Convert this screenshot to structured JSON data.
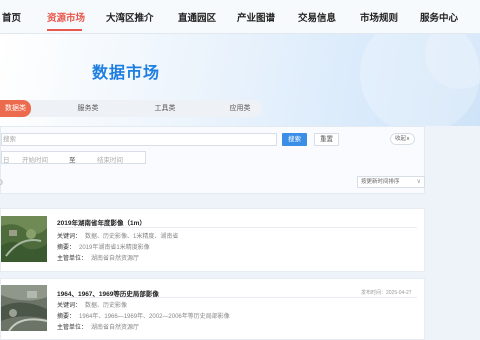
{
  "nav": {
    "items": [
      "首页",
      "资源市场",
      "大湾区推介",
      "直通园区",
      "产业图谱",
      "交易信息",
      "市场规则",
      "服务中心"
    ],
    "active_index": 1
  },
  "hero": {
    "title": "数据市场"
  },
  "categories": {
    "tabs": [
      "数据类",
      "服务类",
      "工具类",
      "应用类"
    ],
    "active_index": 0
  },
  "search": {
    "placeholder": "搜索",
    "search_label": "搜索",
    "reset_label": "重置",
    "collapse_label": "收起∧",
    "date_prefix": "日",
    "start_placeholder": "开始时间",
    "separator": "至",
    "end_placeholder": "结束时间"
  },
  "list": {
    "header_mark": "》",
    "sort_label": "按更新时间排序",
    "sort_arrow": "∨"
  },
  "results": [
    {
      "title": "2019年湖南省年度影像（1m）",
      "keywords_label": "关键词：",
      "keywords": "数据、历史影像、1米精度、湖南省",
      "summary_label": "摘要：",
      "summary": "2019年湖南省1米精度影像",
      "owner_label": "主管单位：",
      "owner": "湖南省自然资源厅",
      "publish": ""
    },
    {
      "title": "1964、1967、1969等历史局部影像",
      "keywords_label": "关键词：",
      "keywords": "数据、历史影像",
      "summary_label": "摘要：",
      "summary": "1964年、1966—1969年、2002—2006年等历史局部影像",
      "owner_label": "主管单位：",
      "owner": "湖南省自然资源厅",
      "publish": "发布时间：2025-04-27"
    }
  ],
  "colors": {
    "accent": "#e8584c",
    "primary": "#3a8ee6",
    "hero_title": "#1f7fe0"
  }
}
